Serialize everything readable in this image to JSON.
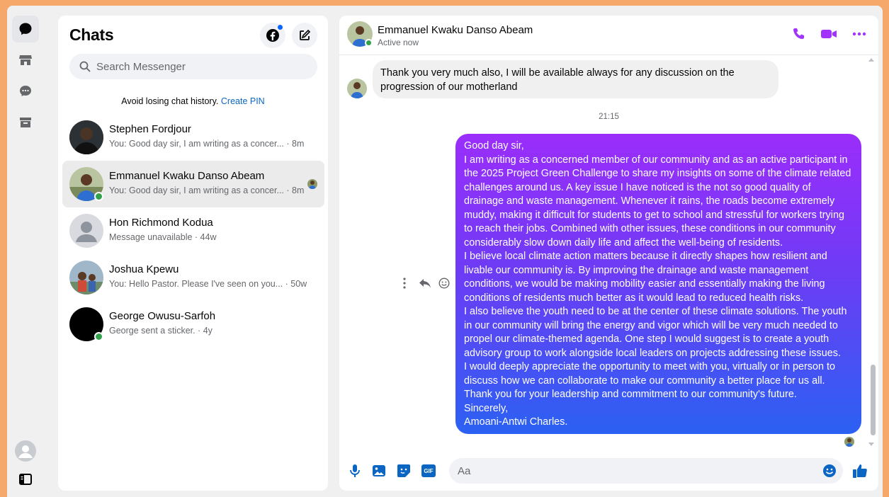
{
  "colors": {
    "accent": "#0a66c2",
    "messenger_purple": "#a033ff",
    "online_green": "#31a24c",
    "outer_border": "#f5a86a"
  },
  "rail": {
    "items": [
      {
        "name": "chats-icon",
        "active": true
      },
      {
        "name": "marketplace-icon",
        "active": false
      },
      {
        "name": "requests-icon",
        "active": false
      },
      {
        "name": "archive-icon",
        "active": false
      }
    ]
  },
  "sidebar": {
    "title": "Chats",
    "search_placeholder": "Search Messenger",
    "pin_note": "Avoid losing chat history.",
    "pin_link": "Create PIN",
    "conversations": [
      {
        "name": "Stephen Fordjour",
        "preview": "You: Good day sir, I am writing as a concer... · 8m"
      },
      {
        "name": "Emmanuel Kwaku Danso Abeam",
        "preview": "You: Good day sir, I am writing as a concer... · 8m"
      },
      {
        "name": "Hon Richmond Kodua",
        "preview": "Message unavailable · 44w"
      },
      {
        "name": "Joshua Kpewu",
        "preview": "You: Hello Pastor. Please I've seen on you... · 50w"
      },
      {
        "name": "George Owusu-Sarfoh",
        "preview": "George sent a sticker. · 4y"
      }
    ]
  },
  "chat": {
    "name": "Emmanuel Kwaku Danso Abeam",
    "status": "Active now",
    "incoming": "Thank you very much also, I will be available always for any discussion on the progression of our motherland",
    "timestamp": "21:15",
    "outgoing": "Good day sir,\nI am writing as a concerned member of our community and as an active participant in the 2025 Project Green Challenge to share my insights on some of the climate related challenges around us. A key issue I have noticed is the not so good quality of drainage and waste management. Whenever it rains, the roads become extremely muddy, making it difficult for students to get to school and stressful for workers trying to reach their jobs. Combined with other issues, these conditions in our community considerably slow down daily life and affect the well-being of residents.\nI believe local climate action matters because it directly shapes how resilient and livable our community is. By improving the drainage and waste management conditions, we would be making mobility easier and essentially making the living conditions of residents much better as it would lead to reduced health risks.\nI also believe the youth need to be at the center of these climate solutions. The youth in our community will bring the energy and vigor which will be very much needed to propel our climate-themed agenda. One step I would suggest is to create a youth advisory group to work alongside local leaders on projects addressing these issues.\nI would deeply appreciate the opportunity to meet with you, virtually or in person to discuss how we can collaborate to make our community a better place for us all.\nThank you for your leadership and commitment to our community's future.\nSincerely,\nAmoani-Antwi Charles.",
    "composer_placeholder": "Aa",
    "gif_label": "GIF"
  }
}
